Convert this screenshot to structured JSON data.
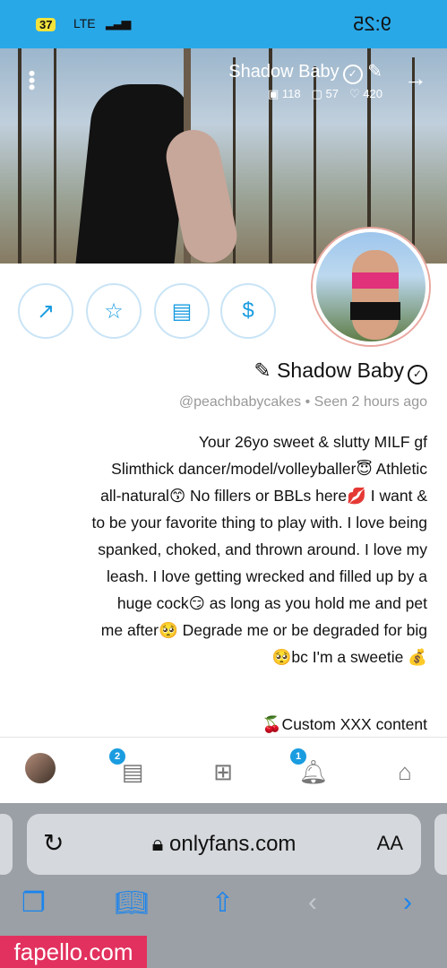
{
  "status_bar": {
    "time": "9:25",
    "network": "LTE",
    "battery": "37"
  },
  "header": {
    "title": "Shadow Baby",
    "stats": [
      "118",
      "57",
      "420"
    ]
  },
  "profile": {
    "name": "Shadow Baby",
    "handle": "@peachbabycakes",
    "separator": "•",
    "last_seen": "Seen 2 hours ago",
    "bio_lines": [
      "Your 26yo sweet & slutty MILF gf",
      "Slimthick dancer/model/volleyballer😇 Athletic",
      "& all-natural😙 No fillers or BBLs here💋 I want",
      "to be your favorite thing to play with. I love being",
      "spanked, choked, and thrown around. I love my",
      "leash. I love getting wrecked and filled up by a",
      "huge cock😏 as long as you hold me and pet",
      "me after🥺 Degrade me or be degraded for big",
      "💰 bc I'm a sweetie🥺"
    ],
    "custom_line": "🍒Custom XXX content"
  },
  "nav": {
    "messages_badge": "2",
    "notifications_badge": "1"
  },
  "browser": {
    "url": "onlyfans.com",
    "aa": "AA"
  },
  "watermark": "fapello.com",
  "colors": {
    "accent": "#1a9ce0",
    "status_bar": "#29a8e8"
  }
}
